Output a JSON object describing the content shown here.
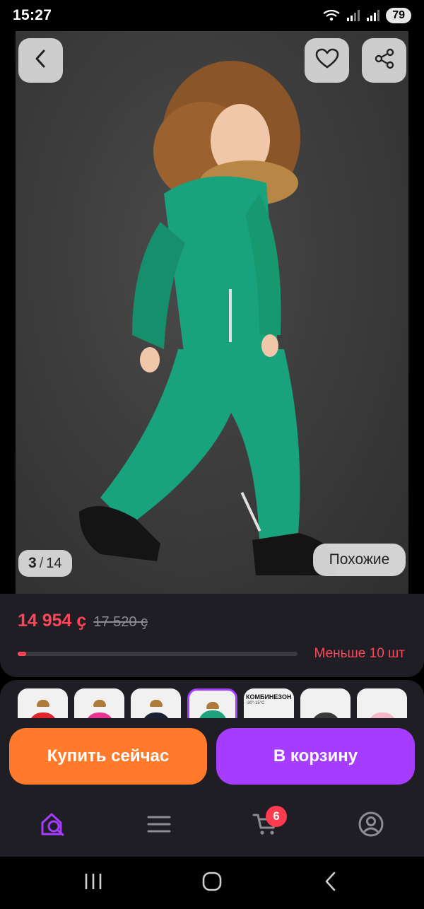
{
  "status_bar": {
    "time": "15:27",
    "battery": "79",
    "icons": [
      "wifi-icon",
      "signal-icon",
      "signal-roaming-icon"
    ]
  },
  "gallery": {
    "current": "3",
    "separator": "/",
    "total": "14",
    "similar_label": "Похожие",
    "icons": {
      "back": "chevron-left-icon",
      "favorite": "heart-icon",
      "share": "share-icon"
    }
  },
  "price": {
    "current": "14 954 ҫ",
    "old": "17 520 ҫ",
    "stock_label": "Меньше 10 шт",
    "stock_level": 0.03,
    "colors": {
      "price": "#ff4557",
      "progress_track": "#3a3940"
    }
  },
  "thumbnails": [
    {
      "color": "#e0252b",
      "selected": false
    },
    {
      "color": "#e8358f",
      "selected": false
    },
    {
      "color": "#1b2233",
      "selected": false
    },
    {
      "color": "#1ea37c",
      "selected": true
    },
    {
      "title": "КОМБИНЕЗОН",
      "subtitle": "-30°-15°C",
      "selected": false
    },
    {
      "color": "#3a3a3a",
      "selected": false
    },
    {
      "color": "#f2b6c6",
      "selected": false
    }
  ],
  "actions": {
    "buy_now": "Купить сейчас",
    "add_to_cart": "В корзину",
    "colors": {
      "buy": "#ff7a2a",
      "cart": "#a63cff"
    }
  },
  "bottom_nav": {
    "items": [
      "home-search-icon",
      "catalog-menu-icon",
      "cart-icon",
      "profile-icon"
    ],
    "cart_badge": "6",
    "active_color": "#a63cff"
  },
  "system_nav": [
    "recents-icon",
    "home-icon",
    "back-icon"
  ]
}
